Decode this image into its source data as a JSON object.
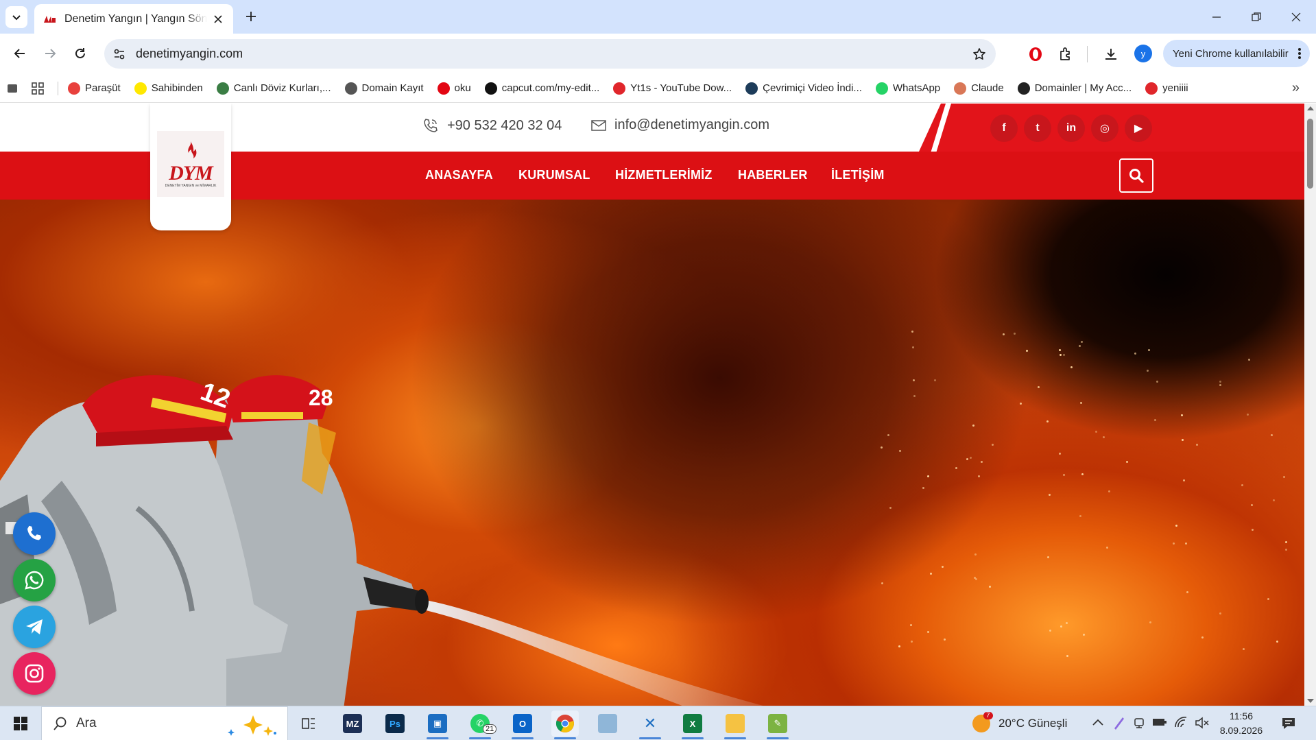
{
  "browser": {
    "tab_title": "Denetim Yangın | Yangın Söndürme",
    "url": "denetimyangin.com",
    "profile_initial": "y",
    "update_label": "Yeni Chrome kullanılabilir"
  },
  "bookmarks": [
    {
      "label": "Paraşüt",
      "icon": "parasut-icon",
      "color": "#e8413d"
    },
    {
      "label": "Sahibinden",
      "icon": "sahibinden-icon",
      "color": "#ffe800"
    },
    {
      "label": "Canlı Döviz Kurları,...",
      "icon": "doviz-icon",
      "color": "#3a7d44"
    },
    {
      "label": "Domain Kayıt",
      "icon": "globe-icon",
      "color": "#555555"
    },
    {
      "label": "oku",
      "icon": "oku-icon",
      "color": "#e30613"
    },
    {
      "label": "capcut.com/my-edit...",
      "icon": "capcut-icon",
      "color": "#111111"
    },
    {
      "label": "Yt1s - YouTube Dow...",
      "icon": "yt1s-icon",
      "color": "#e0262b"
    },
    {
      "label": "Çevrimiçi Video İndi...",
      "icon": "video-download-icon",
      "color": "#1d3c5a"
    },
    {
      "label": "WhatsApp",
      "icon": "whatsapp-icon",
      "color": "#25d366"
    },
    {
      "label": "Claude",
      "icon": "claude-icon",
      "color": "#d97757"
    },
    {
      "label": "Domainler | My Acc...",
      "icon": "wix-icon",
      "color": "#222222"
    },
    {
      "label": "yeniiii",
      "icon": "bookmark-red-icon",
      "color": "#e0262b"
    }
  ],
  "site": {
    "phone": "+90 532 420 32 04",
    "email": "info@denetimyangin.com",
    "logo_text": "DYM",
    "logo_sub": "DENETİM YANGIN ve MİMARLIK",
    "nav": [
      "ANASAYFA",
      "KURUMSAL",
      "HİZMETLERİMİZ",
      "HABERLER",
      "İLETİŞİM"
    ],
    "social": [
      {
        "name": "facebook-icon",
        "glyph": "f"
      },
      {
        "name": "twitter-icon",
        "glyph": "t"
      },
      {
        "name": "linkedin-icon",
        "glyph": "in"
      },
      {
        "name": "instagram-icon",
        "glyph": "◎"
      },
      {
        "name": "youtube-icon",
        "glyph": "▶"
      }
    ],
    "helmet_numbers": [
      "12",
      "28"
    ],
    "colors": {
      "brand_red": "#dc1014",
      "social_red": "#e2141a"
    }
  },
  "taskbar": {
    "search_placeholder": "Ara",
    "weather": "20°C  Güneşli",
    "weather_badge": "7",
    "whatsapp_badge": "21",
    "time": "11:56",
    "date": "8.09.2026"
  }
}
